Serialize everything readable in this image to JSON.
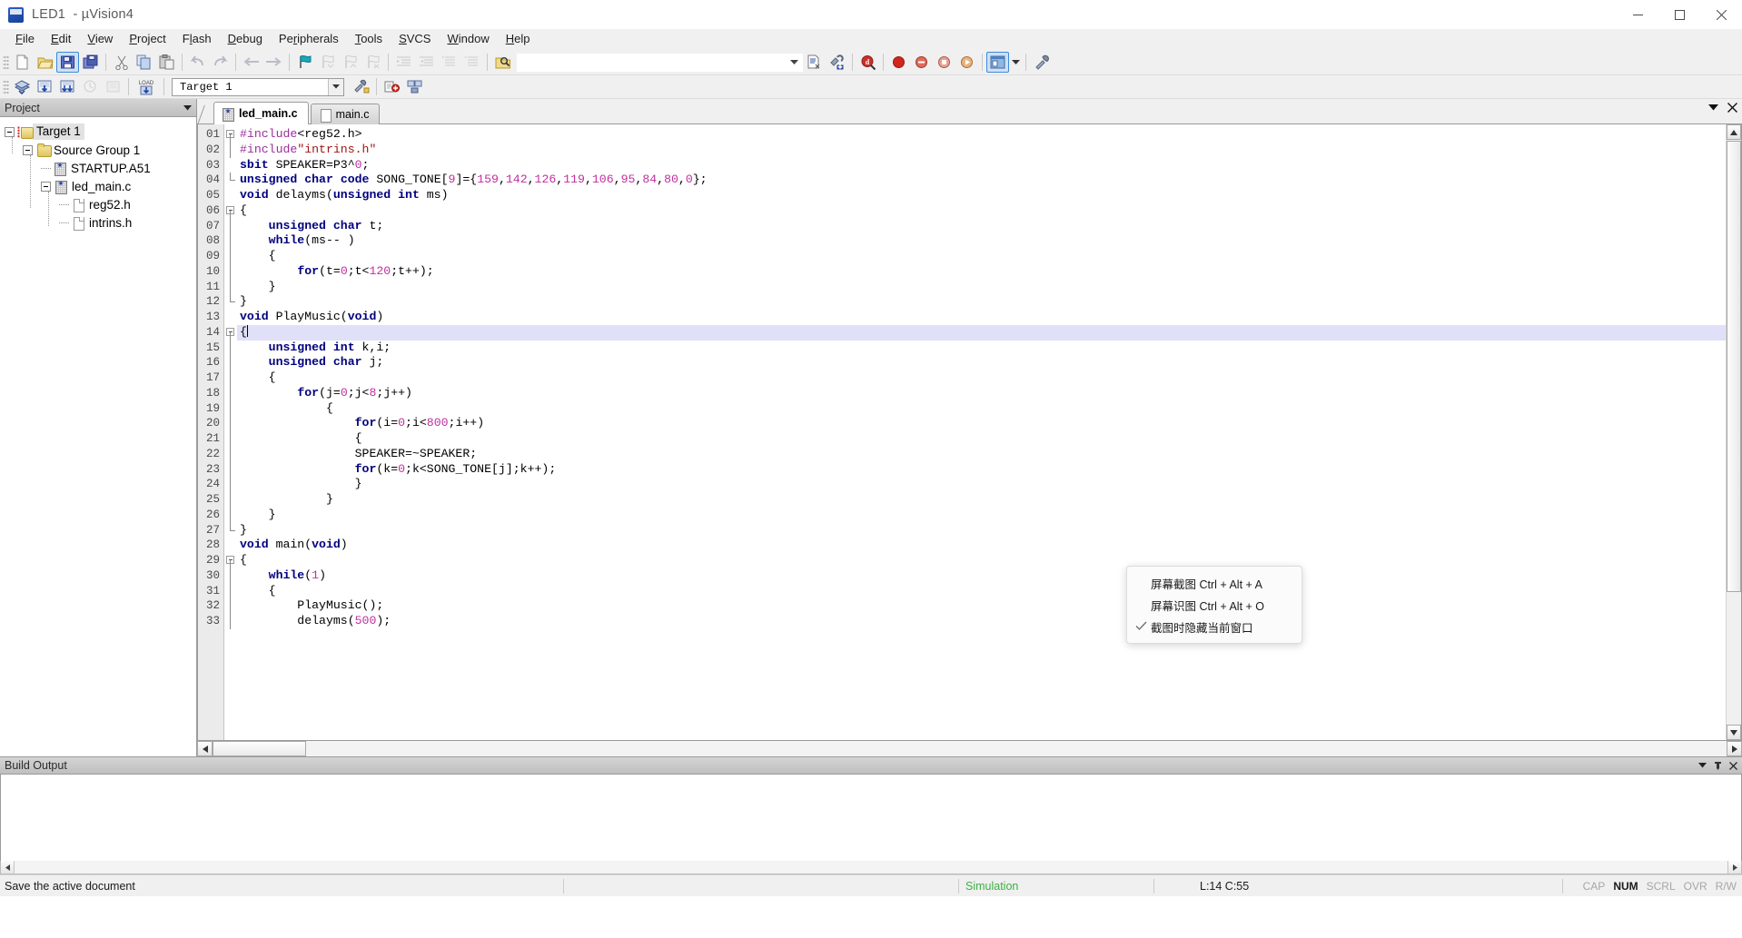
{
  "window": {
    "title": "LED1  - µVision4",
    "logo_icon": "uvision-logo-icon",
    "minimize_icon": "minimize-icon",
    "maximize_icon": "maximize-icon",
    "close_icon": "close-icon"
  },
  "menubar": {
    "items": [
      {
        "label": "File",
        "accel": "F"
      },
      {
        "label": "Edit",
        "accel": "E"
      },
      {
        "label": "View",
        "accel": "V"
      },
      {
        "label": "Project",
        "accel": "P"
      },
      {
        "label": "Flash",
        "accel": "l"
      },
      {
        "label": "Debug",
        "accel": "D"
      },
      {
        "label": "Peripherals",
        "accel": "P"
      },
      {
        "label": "Tools",
        "accel": "T"
      },
      {
        "label": "SVCS",
        "accel": "S"
      },
      {
        "label": "Window",
        "accel": "W"
      },
      {
        "label": "Help",
        "accel": "H"
      }
    ]
  },
  "toolbar_main": {
    "buttons": [
      {
        "name": "new-file-button",
        "icon": "new-document-icon"
      },
      {
        "name": "open-file-button",
        "icon": "open-folder-icon"
      },
      {
        "name": "save-button",
        "icon": "save-disk-icon",
        "pressed": true
      },
      {
        "name": "save-all-button",
        "icon": "save-all-icon"
      },
      {
        "name": "cut-button",
        "icon": "scissors-icon"
      },
      {
        "name": "copy-button",
        "icon": "copy-icon"
      },
      {
        "name": "paste-button",
        "icon": "paste-icon"
      },
      {
        "name": "undo-button",
        "icon": "undo-arrow-icon"
      },
      {
        "name": "redo-button",
        "icon": "redo-arrow-icon"
      },
      {
        "name": "navigate-back-button",
        "icon": "arrow-left-icon"
      },
      {
        "name": "navigate-forward-button",
        "icon": "arrow-right-icon"
      },
      {
        "name": "bookmark-toggle-button",
        "icon": "bookmark-flag-icon"
      },
      {
        "name": "bookmark-prev-button",
        "icon": "bookmark-prev-icon"
      },
      {
        "name": "bookmark-next-button",
        "icon": "bookmark-next-icon"
      },
      {
        "name": "bookmark-clear-button",
        "icon": "bookmark-clear-icon"
      },
      {
        "name": "indent-button",
        "icon": "indent-right-icon"
      },
      {
        "name": "outdent-button",
        "icon": "indent-left-icon"
      },
      {
        "name": "comment-button",
        "icon": "comment-lines-icon"
      },
      {
        "name": "uncomment-button",
        "icon": "uncomment-lines-icon"
      },
      {
        "name": "find-in-files-button",
        "icon": "find-folder-icon"
      }
    ],
    "find_combo_value": "",
    "find_combo_placeholder": "",
    "right_buttons": [
      {
        "name": "insert-file-button",
        "icon": "insert-file-icon"
      },
      {
        "name": "configure-button",
        "icon": "wrench-config-icon"
      },
      {
        "name": "debug-start-button",
        "icon": "magnify-d-icon"
      },
      {
        "name": "record-macro-button",
        "icon": "record-red-dot-icon"
      },
      {
        "name": "play-macro-button",
        "icon": "macro-circle-icon"
      },
      {
        "name": "stop-macro-button",
        "icon": "macro-stop-icon"
      },
      {
        "name": "tool-circle-button",
        "icon": "macro-orange-icon"
      },
      {
        "name": "window-layout-button",
        "icon": "window-layout-icon",
        "pressed": true
      },
      {
        "name": "layout-dropdown-button",
        "icon": "chevron-down-icon"
      },
      {
        "name": "configure-target-button",
        "icon": "wrench-icon"
      }
    ]
  },
  "toolbar_build": {
    "buttons": [
      {
        "name": "translate-button",
        "icon": "translate-file-icon"
      },
      {
        "name": "build-target-button",
        "icon": "build-icon"
      },
      {
        "name": "rebuild-all-button",
        "icon": "rebuild-all-icon"
      },
      {
        "name": "batch-build-button",
        "icon": "batch-build-icon"
      },
      {
        "name": "stop-build-button",
        "icon": "stop-build-icon"
      },
      {
        "name": "download-button",
        "icon": "load-download-icon",
        "label": "LOAD"
      }
    ],
    "target_label": "Target 1",
    "target_dropdown_icon": "chevron-down-icon",
    "after_buttons": [
      {
        "name": "target-options-button",
        "icon": "target-options-icon"
      },
      {
        "name": "manage-components-button",
        "icon": "manage-components-icon"
      },
      {
        "name": "manage-multi-project-button",
        "icon": "multi-project-icon"
      }
    ]
  },
  "project_pane": {
    "title": "Project",
    "dropdown_icon": "chevron-down-icon",
    "pin_icon": "pin-icon",
    "close_icon": "close-icon",
    "tree": [
      {
        "label": "Target 1",
        "icon": "target-folder-icon",
        "level": 0,
        "expander": "minus",
        "selected": true
      },
      {
        "label": "Source Group 1",
        "icon": "folder-icon",
        "level": 1,
        "expander": "minus",
        "selected": false
      },
      {
        "label": "STARTUP.A51",
        "icon": "source-file-icon",
        "level": 2,
        "expander": "none",
        "selected": false
      },
      {
        "label": "led_main.c",
        "icon": "source-file-icon",
        "level": 2,
        "expander": "minus",
        "selected": false
      },
      {
        "label": "reg52.h",
        "icon": "header-file-icon",
        "level": 3,
        "expander": "none",
        "selected": false
      },
      {
        "label": "intrins.h",
        "icon": "header-file-icon",
        "level": 3,
        "expander": "none",
        "selected": false
      }
    ]
  },
  "editor": {
    "tabs": [
      {
        "label": "led_main.c",
        "icon": "source-file-icon",
        "active": true
      },
      {
        "label": "main.c",
        "icon": "plain-file-icon",
        "active": false
      }
    ],
    "dropdown_icon": "chevron-down-icon",
    "close_icon": "close-icon",
    "highlighted_line": 14,
    "lines": [
      {
        "num": "01",
        "fold": "start",
        "tokens": [
          {
            "t": "#include",
            "c": "pp"
          },
          {
            "t": "<reg52.h>",
            "c": "d"
          }
        ]
      },
      {
        "num": "02",
        "fold": "mid-none",
        "tokens": [
          {
            "t": "#include",
            "c": "pp"
          },
          {
            "t": "\"intrins.h\"",
            "c": "s"
          }
        ]
      },
      {
        "num": "03",
        "fold": "none",
        "tokens": [
          {
            "t": "sbit",
            "c": "k"
          },
          {
            "t": " SPEAKER=P3^",
            "c": "d"
          },
          {
            "t": "0",
            "c": "n"
          },
          {
            "t": ";",
            "c": "d"
          }
        ]
      },
      {
        "num": "04",
        "fold": "end",
        "tokens": [
          {
            "t": "unsigned char",
            "c": "k"
          },
          {
            "t": " ",
            "c": "d"
          },
          {
            "t": "code",
            "c": "k"
          },
          {
            "t": " SONG_TONE[",
            "c": "d"
          },
          {
            "t": "9",
            "c": "n"
          },
          {
            "t": "]={",
            "c": "d"
          },
          {
            "t": "159",
            "c": "n"
          },
          {
            "t": ",",
            "c": "d"
          },
          {
            "t": "142",
            "c": "n"
          },
          {
            "t": ",",
            "c": "d"
          },
          {
            "t": "126",
            "c": "n"
          },
          {
            "t": ",",
            "c": "d"
          },
          {
            "t": "119",
            "c": "n"
          },
          {
            "t": ",",
            "c": "d"
          },
          {
            "t": "106",
            "c": "n"
          },
          {
            "t": ",",
            "c": "d"
          },
          {
            "t": "95",
            "c": "n"
          },
          {
            "t": ",",
            "c": "d"
          },
          {
            "t": "84",
            "c": "n"
          },
          {
            "t": ",",
            "c": "d"
          },
          {
            "t": "80",
            "c": "n"
          },
          {
            "t": ",",
            "c": "d"
          },
          {
            "t": "0",
            "c": "n"
          },
          {
            "t": "};",
            "c": "d"
          }
        ]
      },
      {
        "num": "05",
        "fold": "none",
        "tokens": [
          {
            "t": "void",
            "c": "k"
          },
          {
            "t": " delayms(",
            "c": "d"
          },
          {
            "t": "unsigned int",
            "c": "k"
          },
          {
            "t": " ms)",
            "c": "d"
          }
        ]
      },
      {
        "num": "06",
        "fold": "start",
        "tokens": [
          {
            "t": "{",
            "c": "d"
          }
        ]
      },
      {
        "num": "07",
        "fold": "mid",
        "tokens": [
          {
            "t": "    ",
            "c": "d"
          },
          {
            "t": "unsigned char",
            "c": "k"
          },
          {
            "t": " t;",
            "c": "d"
          }
        ]
      },
      {
        "num": "08",
        "fold": "mid",
        "tokens": [
          {
            "t": "    ",
            "c": "d"
          },
          {
            "t": "while",
            "c": "k"
          },
          {
            "t": "(ms-- )",
            "c": "d"
          }
        ]
      },
      {
        "num": "09",
        "fold": "mid",
        "tokens": [
          {
            "t": "    {",
            "c": "d"
          }
        ]
      },
      {
        "num": "10",
        "fold": "mid",
        "tokens": [
          {
            "t": "        ",
            "c": "d"
          },
          {
            "t": "for",
            "c": "k"
          },
          {
            "t": "(t=",
            "c": "d"
          },
          {
            "t": "0",
            "c": "n"
          },
          {
            "t": ";t<",
            "c": "d"
          },
          {
            "t": "120",
            "c": "n"
          },
          {
            "t": ";t++);",
            "c": "d"
          }
        ]
      },
      {
        "num": "11",
        "fold": "mid",
        "tokens": [
          {
            "t": "    }",
            "c": "d"
          }
        ]
      },
      {
        "num": "12",
        "fold": "end",
        "tokens": [
          {
            "t": "}",
            "c": "d"
          }
        ]
      },
      {
        "num": "13",
        "fold": "none",
        "tokens": [
          {
            "t": "void",
            "c": "k"
          },
          {
            "t": " PlayMusic(",
            "c": "d"
          },
          {
            "t": "void",
            "c": "k"
          },
          {
            "t": ")",
            "c": "d"
          }
        ]
      },
      {
        "num": "14",
        "fold": "start",
        "tokens": [
          {
            "t": "{",
            "c": "d"
          }
        ]
      },
      {
        "num": "15",
        "fold": "mid",
        "tokens": [
          {
            "t": "    ",
            "c": "d"
          },
          {
            "t": "unsigned int",
            "c": "k"
          },
          {
            "t": " k,i;",
            "c": "d"
          }
        ]
      },
      {
        "num": "16",
        "fold": "mid",
        "tokens": [
          {
            "t": "    ",
            "c": "d"
          },
          {
            "t": "unsigned char",
            "c": "k"
          },
          {
            "t": " j;",
            "c": "d"
          }
        ]
      },
      {
        "num": "17",
        "fold": "mid",
        "tokens": [
          {
            "t": "    {",
            "c": "d"
          }
        ]
      },
      {
        "num": "18",
        "fold": "mid",
        "tokens": [
          {
            "t": "        ",
            "c": "d"
          },
          {
            "t": "for",
            "c": "k"
          },
          {
            "t": "(j=",
            "c": "d"
          },
          {
            "t": "0",
            "c": "n"
          },
          {
            "t": ";j<",
            "c": "d"
          },
          {
            "t": "8",
            "c": "n"
          },
          {
            "t": ";j++)",
            "c": "d"
          }
        ]
      },
      {
        "num": "19",
        "fold": "mid",
        "tokens": [
          {
            "t": "            {",
            "c": "d"
          }
        ]
      },
      {
        "num": "20",
        "fold": "mid",
        "tokens": [
          {
            "t": "                ",
            "c": "d"
          },
          {
            "t": "for",
            "c": "k"
          },
          {
            "t": "(i=",
            "c": "d"
          },
          {
            "t": "0",
            "c": "n"
          },
          {
            "t": ";i<",
            "c": "d"
          },
          {
            "t": "800",
            "c": "n"
          },
          {
            "t": ";i++)",
            "c": "d"
          }
        ]
      },
      {
        "num": "21",
        "fold": "mid",
        "tokens": [
          {
            "t": "                {",
            "c": "d"
          }
        ]
      },
      {
        "num": "22",
        "fold": "mid",
        "tokens": [
          {
            "t": "                SPEAKER=~SPEAKER;",
            "c": "d"
          }
        ]
      },
      {
        "num": "23",
        "fold": "mid",
        "tokens": [
          {
            "t": "                ",
            "c": "d"
          },
          {
            "t": "for",
            "c": "k"
          },
          {
            "t": "(k=",
            "c": "d"
          },
          {
            "t": "0",
            "c": "n"
          },
          {
            "t": ";k<SONG_TONE[j];k++);",
            "c": "d"
          }
        ]
      },
      {
        "num": "24",
        "fold": "mid",
        "tokens": [
          {
            "t": "                }",
            "c": "d"
          }
        ]
      },
      {
        "num": "25",
        "fold": "mid",
        "tokens": [
          {
            "t": "            }",
            "c": "d"
          }
        ]
      },
      {
        "num": "26",
        "fold": "mid",
        "tokens": [
          {
            "t": "    }",
            "c": "d"
          }
        ]
      },
      {
        "num": "27",
        "fold": "end",
        "tokens": [
          {
            "t": "}",
            "c": "d"
          }
        ]
      },
      {
        "num": "28",
        "fold": "none",
        "tokens": [
          {
            "t": "void",
            "c": "k"
          },
          {
            "t": " main(",
            "c": "d"
          },
          {
            "t": "void",
            "c": "k"
          },
          {
            "t": ")",
            "c": "d"
          }
        ]
      },
      {
        "num": "29",
        "fold": "start",
        "tokens": [
          {
            "t": "{",
            "c": "d"
          }
        ]
      },
      {
        "num": "30",
        "fold": "mid",
        "tokens": [
          {
            "t": "    ",
            "c": "d"
          },
          {
            "t": "while",
            "c": "k"
          },
          {
            "t": "(",
            "c": "d"
          },
          {
            "t": "1",
            "c": "n"
          },
          {
            "t": ")",
            "c": "d"
          }
        ]
      },
      {
        "num": "31",
        "fold": "mid",
        "tokens": [
          {
            "t": "    {",
            "c": "d"
          }
        ]
      },
      {
        "num": "32",
        "fold": "mid",
        "tokens": [
          {
            "t": "        PlayMusic();",
            "c": "d"
          }
        ]
      },
      {
        "num": "33",
        "fold": "mid",
        "tokens": [
          {
            "t": "        delayms(",
            "c": "d"
          },
          {
            "t": "500",
            "c": "n"
          },
          {
            "t": ");",
            "c": "d"
          }
        ]
      }
    ]
  },
  "context_menu": {
    "items": [
      {
        "label": "屏幕截图 Ctrl + Alt + A",
        "checked": false,
        "name": "screen-capture-item"
      },
      {
        "label": "屏幕识图 Ctrl + Alt + O",
        "checked": false,
        "name": "screen-ocr-item"
      },
      {
        "label": "截图时隐藏当前窗口",
        "checked": true,
        "name": "hide-window-on-capture-item"
      }
    ],
    "check_icon": "checkmark-icon"
  },
  "build_output": {
    "title": "Build Output",
    "dropdown_icon": "chevron-down-icon",
    "pin_icon": "pin-icon",
    "close_icon": "close-icon",
    "text": "",
    "scroll_left_icon": "chevron-left-icon",
    "scroll_right_icon": "chevron-right-icon"
  },
  "statusbar": {
    "message": "Save the active document",
    "simulation": "Simulation",
    "position": "L:14 C:55",
    "flags": [
      {
        "label": "CAP",
        "on": false
      },
      {
        "label": "NUM",
        "on": true
      },
      {
        "label": "SCRL",
        "on": false
      },
      {
        "label": "OVR",
        "on": false
      },
      {
        "label": "R/W",
        "on": false
      }
    ]
  },
  "colors": {
    "accent": "#3c8ad9",
    "keyword": "#00007f",
    "number": "#c030a0",
    "string": "#a31515",
    "preprocessor": "#9a2f9a",
    "simulation_green": "#3cb043",
    "titlebar_bg": "#ffffff",
    "chrome_bg": "#f0f0f0",
    "highlight_line": "#e0e0f8"
  }
}
